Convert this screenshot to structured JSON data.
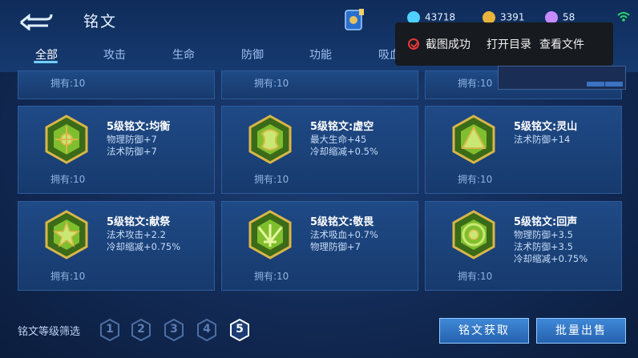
{
  "header": {
    "title": "铭文",
    "resources": [
      {
        "icon": "diamond-icon",
        "value": "43718"
      },
      {
        "icon": "gold-coin-icon",
        "value": "3391"
      },
      {
        "icon": "gem-icon",
        "value": "58"
      }
    ]
  },
  "tabs": [
    "全部",
    "攻击",
    "生命",
    "防御",
    "功能",
    "吸血"
  ],
  "toast": {
    "message": "截图成功",
    "open_dir": "打开目录",
    "view_file": "查看文件"
  },
  "top_row_owned": [
    "拥有:10",
    "拥有:10",
    "拥有:10"
  ],
  "cards": [
    {
      "name": "5级铭文:均衡",
      "attrs": [
        "物理防御+7",
        "法术防御+7"
      ],
      "owned": "拥有:10",
      "icon": "rune-junheng-icon"
    },
    {
      "name": "5级铭文:虚空",
      "attrs": [
        "最大生命+45",
        "冷却缩减+0.5%"
      ],
      "owned": "拥有:10",
      "icon": "rune-xukong-icon"
    },
    {
      "name": "5级铭文:灵山",
      "attrs": [
        "法术防御+14"
      ],
      "owned": "拥有:10",
      "icon": "rune-lingshan-icon"
    },
    {
      "name": "5级铭文:献祭",
      "attrs": [
        "法术攻击+2.2",
        "冷却缩减+0.75%"
      ],
      "owned": "拥有:10",
      "icon": "rune-xianji-icon"
    },
    {
      "name": "5级铭文:敬畏",
      "attrs": [
        "法术吸血+0.7%",
        "物理防御+7"
      ],
      "owned": "拥有:10",
      "icon": "rune-jingwei-icon"
    },
    {
      "name": "5级铭文:回声",
      "attrs": [
        "物理防御+3.5",
        "法术防御+3.5",
        "冷却缩减+0.75%"
      ],
      "owned": "拥有:10",
      "icon": "rune-huisheng-icon"
    }
  ],
  "footer": {
    "filter_label": "铭文等级筛选",
    "levels": [
      "1",
      "2",
      "3",
      "4",
      "5"
    ],
    "selected_level": "5",
    "acquire_button": "铭文获取",
    "sell_button": "批量出售"
  },
  "colors": {
    "accent": "#6fd0ff",
    "rune_green": "#6fae2a",
    "rune_gold": "#d9b64a",
    "toast_check": "#e5383b"
  }
}
